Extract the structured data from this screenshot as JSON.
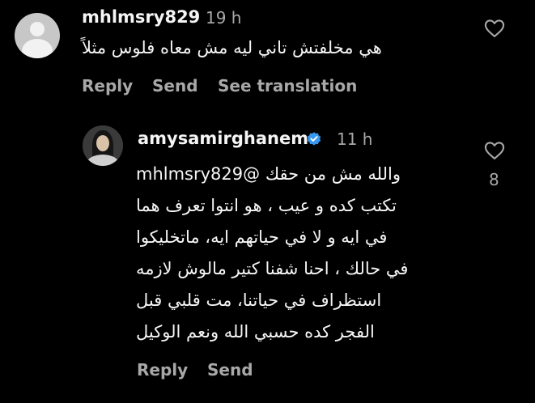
{
  "colors": {
    "background": "#000000",
    "primary_text": "#f5f5f5",
    "secondary_text": "#a8a8a8",
    "verified_badge": "#3897f0"
  },
  "comment_1": {
    "avatar_icon": "default-avatar-icon",
    "username": "mhlmsry829",
    "time": "19 h",
    "text": "هي مخلفتش تاني ليه مش معاه فلوس مثلاً",
    "actions": {
      "reply": "Reply",
      "send": "Send",
      "see_translation": "See translation"
    },
    "like_icon": "heart-outline-icon"
  },
  "comment_2": {
    "avatar_icon": "profile-photo-icon",
    "username": "amysamirghanem",
    "verified_icon": "verified-badge-icon",
    "time": "11 h",
    "text_lines": [
      "والله مش من حقك @mhlmsry829",
      "تكتب كده و عيب ، هو انتوا تعرف هما",
      "في ايه و لا في حياتهم ايه، ماتخليكوا",
      "في حالك ، احنا شفنا كتير مالوش لازمه",
      "استظراف في حياتنا، مت قلبي قبل",
      "الفجر كده حسبي الله ونعم الوكيل"
    ],
    "actions": {
      "reply": "Reply",
      "send": "Send"
    },
    "like_icon": "heart-outline-icon",
    "like_count": "8"
  }
}
